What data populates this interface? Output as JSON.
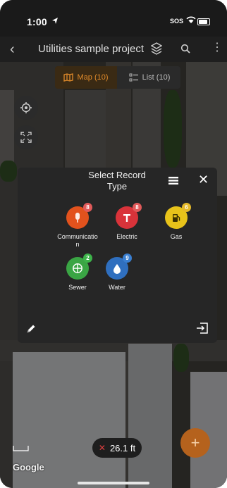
{
  "status_bar": {
    "time": "1:00",
    "sos": "SOS"
  },
  "nav": {
    "title": "Utilities sample project"
  },
  "view_toggle": {
    "map_label": "Map (10)",
    "list_label": "List (10)"
  },
  "modal": {
    "title": "Select Record Type",
    "record_types": [
      {
        "label": "Communication",
        "count": "8",
        "color": "#e2521d",
        "badge_color": "#e05a5a"
      },
      {
        "label": "Electric",
        "count": "8",
        "color": "#d9333a",
        "badge_color": "#e05a5a"
      },
      {
        "label": "Gas",
        "count": "6",
        "color": "#e8c31a",
        "badge_color": "#e5b92b"
      },
      {
        "label": "Sewer",
        "count": "2",
        "color": "#3aa544",
        "badge_color": "#3db34a"
      },
      {
        "label": "Water",
        "count": "9",
        "color": "#2f6fbf",
        "badge_color": "#3a7fd1"
      }
    ]
  },
  "measurement": {
    "value": "26.1 ft"
  },
  "map": {
    "attribution": "Google"
  },
  "fab": {
    "label": "+"
  }
}
